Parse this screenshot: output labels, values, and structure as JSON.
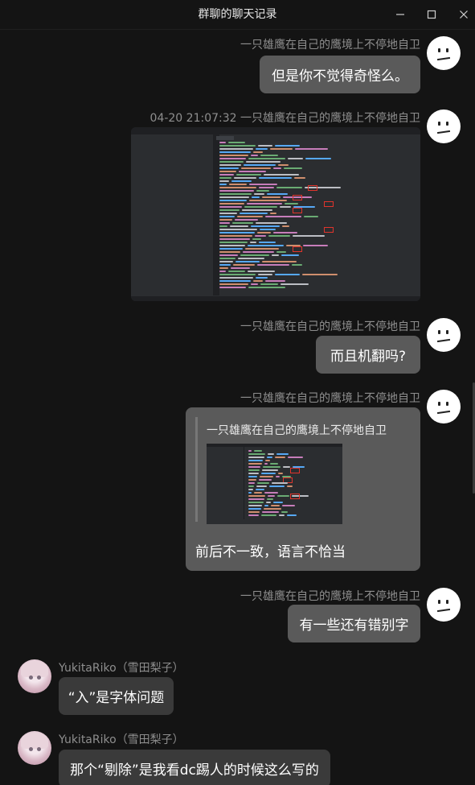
{
  "window": {
    "title": "群聊的聊天记录",
    "controls": {
      "minimize": "minimize-icon",
      "maximize": "maximize-icon",
      "close": "close-icon"
    }
  },
  "messages": [
    {
      "sender": "一只雄鹰在自己的鹰境上不停地自卫",
      "text": "但是你不觉得奇怪么。"
    },
    {
      "timestamp": "04-20 21:07:32",
      "sender": "一只雄鹰在自己的鹰境上不停地自卫",
      "attachment": "code-screenshot"
    },
    {
      "sender": "一只雄鹰在自己的鹰境上不停地自卫",
      "text": "而且机翻吗?"
    },
    {
      "sender": "一只雄鹰在自己的鹰境上不停地自卫",
      "quote": {
        "sender": "一只雄鹰在自己的鹰境上不停地自卫",
        "attachment": "code-screenshot"
      },
      "text": "前后不一致，语言不恰当"
    },
    {
      "sender": "一只雄鹰在自己的鹰境上不停地自卫",
      "text": "有一些还有错别字"
    },
    {
      "sender": "YukitaRiko（雪田梨子）",
      "text": "“入”是字体问题"
    },
    {
      "sender": "YukitaRiko（雪田梨子）",
      "text": "那个“剔除”是我看dc踢人的时候这么写的"
    }
  ],
  "colors": {
    "background": "#141414",
    "own_bubble": "#5a5a5a",
    "other_bubble": "#3a3a3a",
    "sender_text": "#8e8e8e",
    "highlight_box": "#e0342c"
  }
}
